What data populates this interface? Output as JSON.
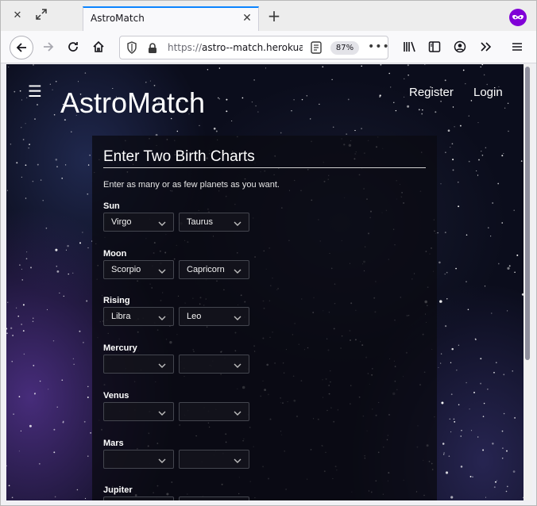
{
  "tab": {
    "title": "AstroMatch"
  },
  "url": {
    "prefix": "https://",
    "host": "astro--match.herokua",
    "zoom": "87%"
  },
  "site": {
    "brand": "AstroMatch",
    "nav": [
      "Register",
      "Login"
    ]
  },
  "form": {
    "title": "Enter Two Birth Charts",
    "intro": "Enter as many or as few planets as you want.",
    "rows": [
      {
        "label": "Sun",
        "a": "Virgo",
        "b": "Taurus"
      },
      {
        "label": "Moon",
        "a": "Scorpio",
        "b": "Capricorn"
      },
      {
        "label": "Rising",
        "a": "Libra",
        "b": "Leo"
      },
      {
        "label": "Mercury",
        "a": "",
        "b": ""
      },
      {
        "label": "Venus",
        "a": "",
        "b": ""
      },
      {
        "label": "Mars",
        "a": "",
        "b": ""
      },
      {
        "label": "Jupiter",
        "a": "",
        "b": ""
      }
    ]
  },
  "colors": {
    "tab_accent": "#0a84ff",
    "private_badge": "#8000d7",
    "panel_bg": "#0a0a12"
  }
}
